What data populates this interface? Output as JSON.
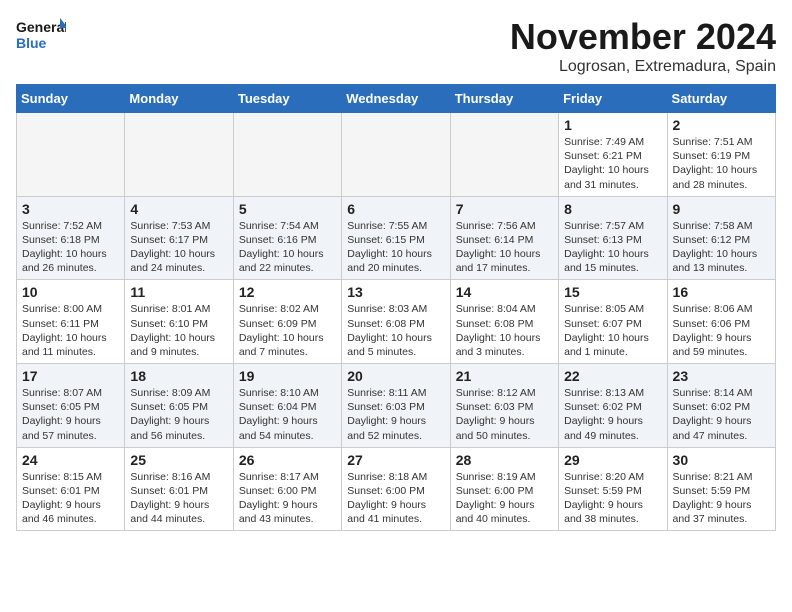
{
  "header": {
    "logo_line1": "General",
    "logo_line2": "Blue",
    "month": "November 2024",
    "location": "Logrosan, Extremadura, Spain"
  },
  "weekdays": [
    "Sunday",
    "Monday",
    "Tuesday",
    "Wednesday",
    "Thursday",
    "Friday",
    "Saturday"
  ],
  "weeks": [
    {
      "days": [
        {
          "num": "",
          "info": ""
        },
        {
          "num": "",
          "info": ""
        },
        {
          "num": "",
          "info": ""
        },
        {
          "num": "",
          "info": ""
        },
        {
          "num": "",
          "info": ""
        },
        {
          "num": "1",
          "info": "Sunrise: 7:49 AM\nSunset: 6:21 PM\nDaylight: 10 hours and 31 minutes."
        },
        {
          "num": "2",
          "info": "Sunrise: 7:51 AM\nSunset: 6:19 PM\nDaylight: 10 hours and 28 minutes."
        }
      ]
    },
    {
      "days": [
        {
          "num": "3",
          "info": "Sunrise: 7:52 AM\nSunset: 6:18 PM\nDaylight: 10 hours and 26 minutes."
        },
        {
          "num": "4",
          "info": "Sunrise: 7:53 AM\nSunset: 6:17 PM\nDaylight: 10 hours and 24 minutes."
        },
        {
          "num": "5",
          "info": "Sunrise: 7:54 AM\nSunset: 6:16 PM\nDaylight: 10 hours and 22 minutes."
        },
        {
          "num": "6",
          "info": "Sunrise: 7:55 AM\nSunset: 6:15 PM\nDaylight: 10 hours and 20 minutes."
        },
        {
          "num": "7",
          "info": "Sunrise: 7:56 AM\nSunset: 6:14 PM\nDaylight: 10 hours and 17 minutes."
        },
        {
          "num": "8",
          "info": "Sunrise: 7:57 AM\nSunset: 6:13 PM\nDaylight: 10 hours and 15 minutes."
        },
        {
          "num": "9",
          "info": "Sunrise: 7:58 AM\nSunset: 6:12 PM\nDaylight: 10 hours and 13 minutes."
        }
      ]
    },
    {
      "days": [
        {
          "num": "10",
          "info": "Sunrise: 8:00 AM\nSunset: 6:11 PM\nDaylight: 10 hours and 11 minutes."
        },
        {
          "num": "11",
          "info": "Sunrise: 8:01 AM\nSunset: 6:10 PM\nDaylight: 10 hours and 9 minutes."
        },
        {
          "num": "12",
          "info": "Sunrise: 8:02 AM\nSunset: 6:09 PM\nDaylight: 10 hours and 7 minutes."
        },
        {
          "num": "13",
          "info": "Sunrise: 8:03 AM\nSunset: 6:08 PM\nDaylight: 10 hours and 5 minutes."
        },
        {
          "num": "14",
          "info": "Sunrise: 8:04 AM\nSunset: 6:08 PM\nDaylight: 10 hours and 3 minutes."
        },
        {
          "num": "15",
          "info": "Sunrise: 8:05 AM\nSunset: 6:07 PM\nDaylight: 10 hours and 1 minute."
        },
        {
          "num": "16",
          "info": "Sunrise: 8:06 AM\nSunset: 6:06 PM\nDaylight: 9 hours and 59 minutes."
        }
      ]
    },
    {
      "days": [
        {
          "num": "17",
          "info": "Sunrise: 8:07 AM\nSunset: 6:05 PM\nDaylight: 9 hours and 57 minutes."
        },
        {
          "num": "18",
          "info": "Sunrise: 8:09 AM\nSunset: 6:05 PM\nDaylight: 9 hours and 56 minutes."
        },
        {
          "num": "19",
          "info": "Sunrise: 8:10 AM\nSunset: 6:04 PM\nDaylight: 9 hours and 54 minutes."
        },
        {
          "num": "20",
          "info": "Sunrise: 8:11 AM\nSunset: 6:03 PM\nDaylight: 9 hours and 52 minutes."
        },
        {
          "num": "21",
          "info": "Sunrise: 8:12 AM\nSunset: 6:03 PM\nDaylight: 9 hours and 50 minutes."
        },
        {
          "num": "22",
          "info": "Sunrise: 8:13 AM\nSunset: 6:02 PM\nDaylight: 9 hours and 49 minutes."
        },
        {
          "num": "23",
          "info": "Sunrise: 8:14 AM\nSunset: 6:02 PM\nDaylight: 9 hours and 47 minutes."
        }
      ]
    },
    {
      "days": [
        {
          "num": "24",
          "info": "Sunrise: 8:15 AM\nSunset: 6:01 PM\nDaylight: 9 hours and 46 minutes."
        },
        {
          "num": "25",
          "info": "Sunrise: 8:16 AM\nSunset: 6:01 PM\nDaylight: 9 hours and 44 minutes."
        },
        {
          "num": "26",
          "info": "Sunrise: 8:17 AM\nSunset: 6:00 PM\nDaylight: 9 hours and 43 minutes."
        },
        {
          "num": "27",
          "info": "Sunrise: 8:18 AM\nSunset: 6:00 PM\nDaylight: 9 hours and 41 minutes."
        },
        {
          "num": "28",
          "info": "Sunrise: 8:19 AM\nSunset: 6:00 PM\nDaylight: 9 hours and 40 minutes."
        },
        {
          "num": "29",
          "info": "Sunrise: 8:20 AM\nSunset: 5:59 PM\nDaylight: 9 hours and 38 minutes."
        },
        {
          "num": "30",
          "info": "Sunrise: 8:21 AM\nSunset: 5:59 PM\nDaylight: 9 hours and 37 minutes."
        }
      ]
    }
  ]
}
